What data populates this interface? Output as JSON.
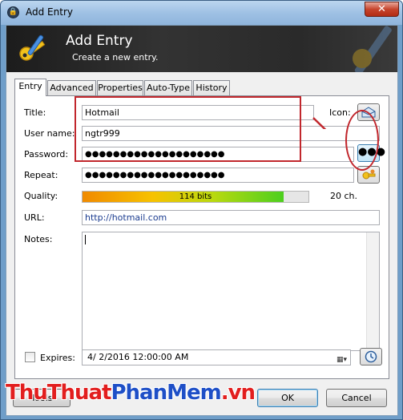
{
  "window": {
    "title": "Add Entry",
    "close_glyph": "✕"
  },
  "banner": {
    "title": "Add Entry",
    "subtitle": "Create a new entry."
  },
  "tabs": [
    {
      "label": "Entry",
      "active": true
    },
    {
      "label": "Advanced"
    },
    {
      "label": "Properties"
    },
    {
      "label": "Auto-Type"
    },
    {
      "label": "History"
    }
  ],
  "form": {
    "title_label": "Title:",
    "title_value": "Hotmail",
    "icon_label": "Icon:",
    "username_label": "User name:",
    "username_value": "ngtr999",
    "password_label": "Password:",
    "password_value": "●●●●●●●●●●●●●●●●●●●●",
    "repeat_label": "Repeat:",
    "repeat_value": "●●●●●●●●●●●●●●●●●●●●",
    "quality_label": "Quality:",
    "quality_text": "114 bits",
    "quality_fraction": 0.89,
    "length_text": "20 ch.",
    "url_label": "URL:",
    "url_value": "http://hotmail.com",
    "notes_label": "Notes:",
    "notes_value": "",
    "expires_label": "Expires:",
    "expires_value": "4/  2/2016 12:00:00 AM",
    "show_password_label": "●●●"
  },
  "buttons": {
    "tools": "Tools",
    "ok": "OK",
    "cancel": "Cancel"
  },
  "watermark": {
    "part1": "ThuThuat",
    "part2": "PhanMem",
    "part3": ".vn"
  },
  "colors": {
    "highlight": "#c1272d",
    "titlebar": "#9fc1e4",
    "banner": "#2a2a2a"
  }
}
